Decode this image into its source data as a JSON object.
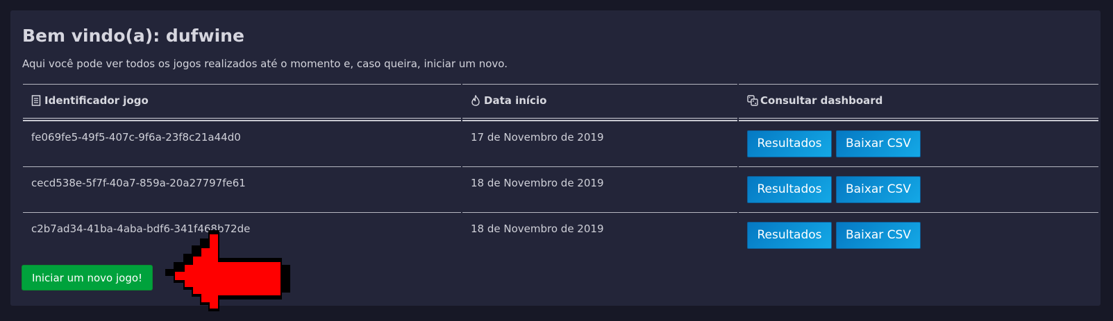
{
  "welcome": {
    "title": "Bem vindo(a): dufwine",
    "subtitle": "Aqui você pode ver todos os jogos realizados até o momento e, caso queira, iniciar um novo."
  },
  "table": {
    "headers": [
      {
        "label": "Identificador jogo",
        "icon": "document-list-icon"
      },
      {
        "label": "Data início",
        "icon": "fire-icon"
      },
      {
        "label": "Consultar dashboard",
        "icon": "dice-icon"
      }
    ],
    "rows": [
      {
        "id": "fe069fe5-49f5-407c-9f6a-23f8c21a44d0",
        "date": "17 de Novembro de 2019",
        "results_label": "Resultados",
        "csv_label": "Baixar CSV"
      },
      {
        "id": "cecd538e-5f7f-40a7-859a-20a27797fe61",
        "date": "18 de Novembro de 2019",
        "results_label": "Resultados",
        "csv_label": "Baixar CSV"
      },
      {
        "id": "c2b7ad34-41ba-4aba-bdf6-341f468b72de",
        "date": "18 de Novembro de 2019",
        "results_label": "Resultados",
        "csv_label": "Baixar CSV"
      }
    ]
  },
  "actions": {
    "new_game_label": "Iniciar um novo jogo!"
  },
  "colors": {
    "page_bg": "#171826",
    "panel_bg": "#232539",
    "primary_button": "#0a8fd4",
    "success_button": "#00a23c",
    "pointer_arrow": "#ff0000"
  }
}
